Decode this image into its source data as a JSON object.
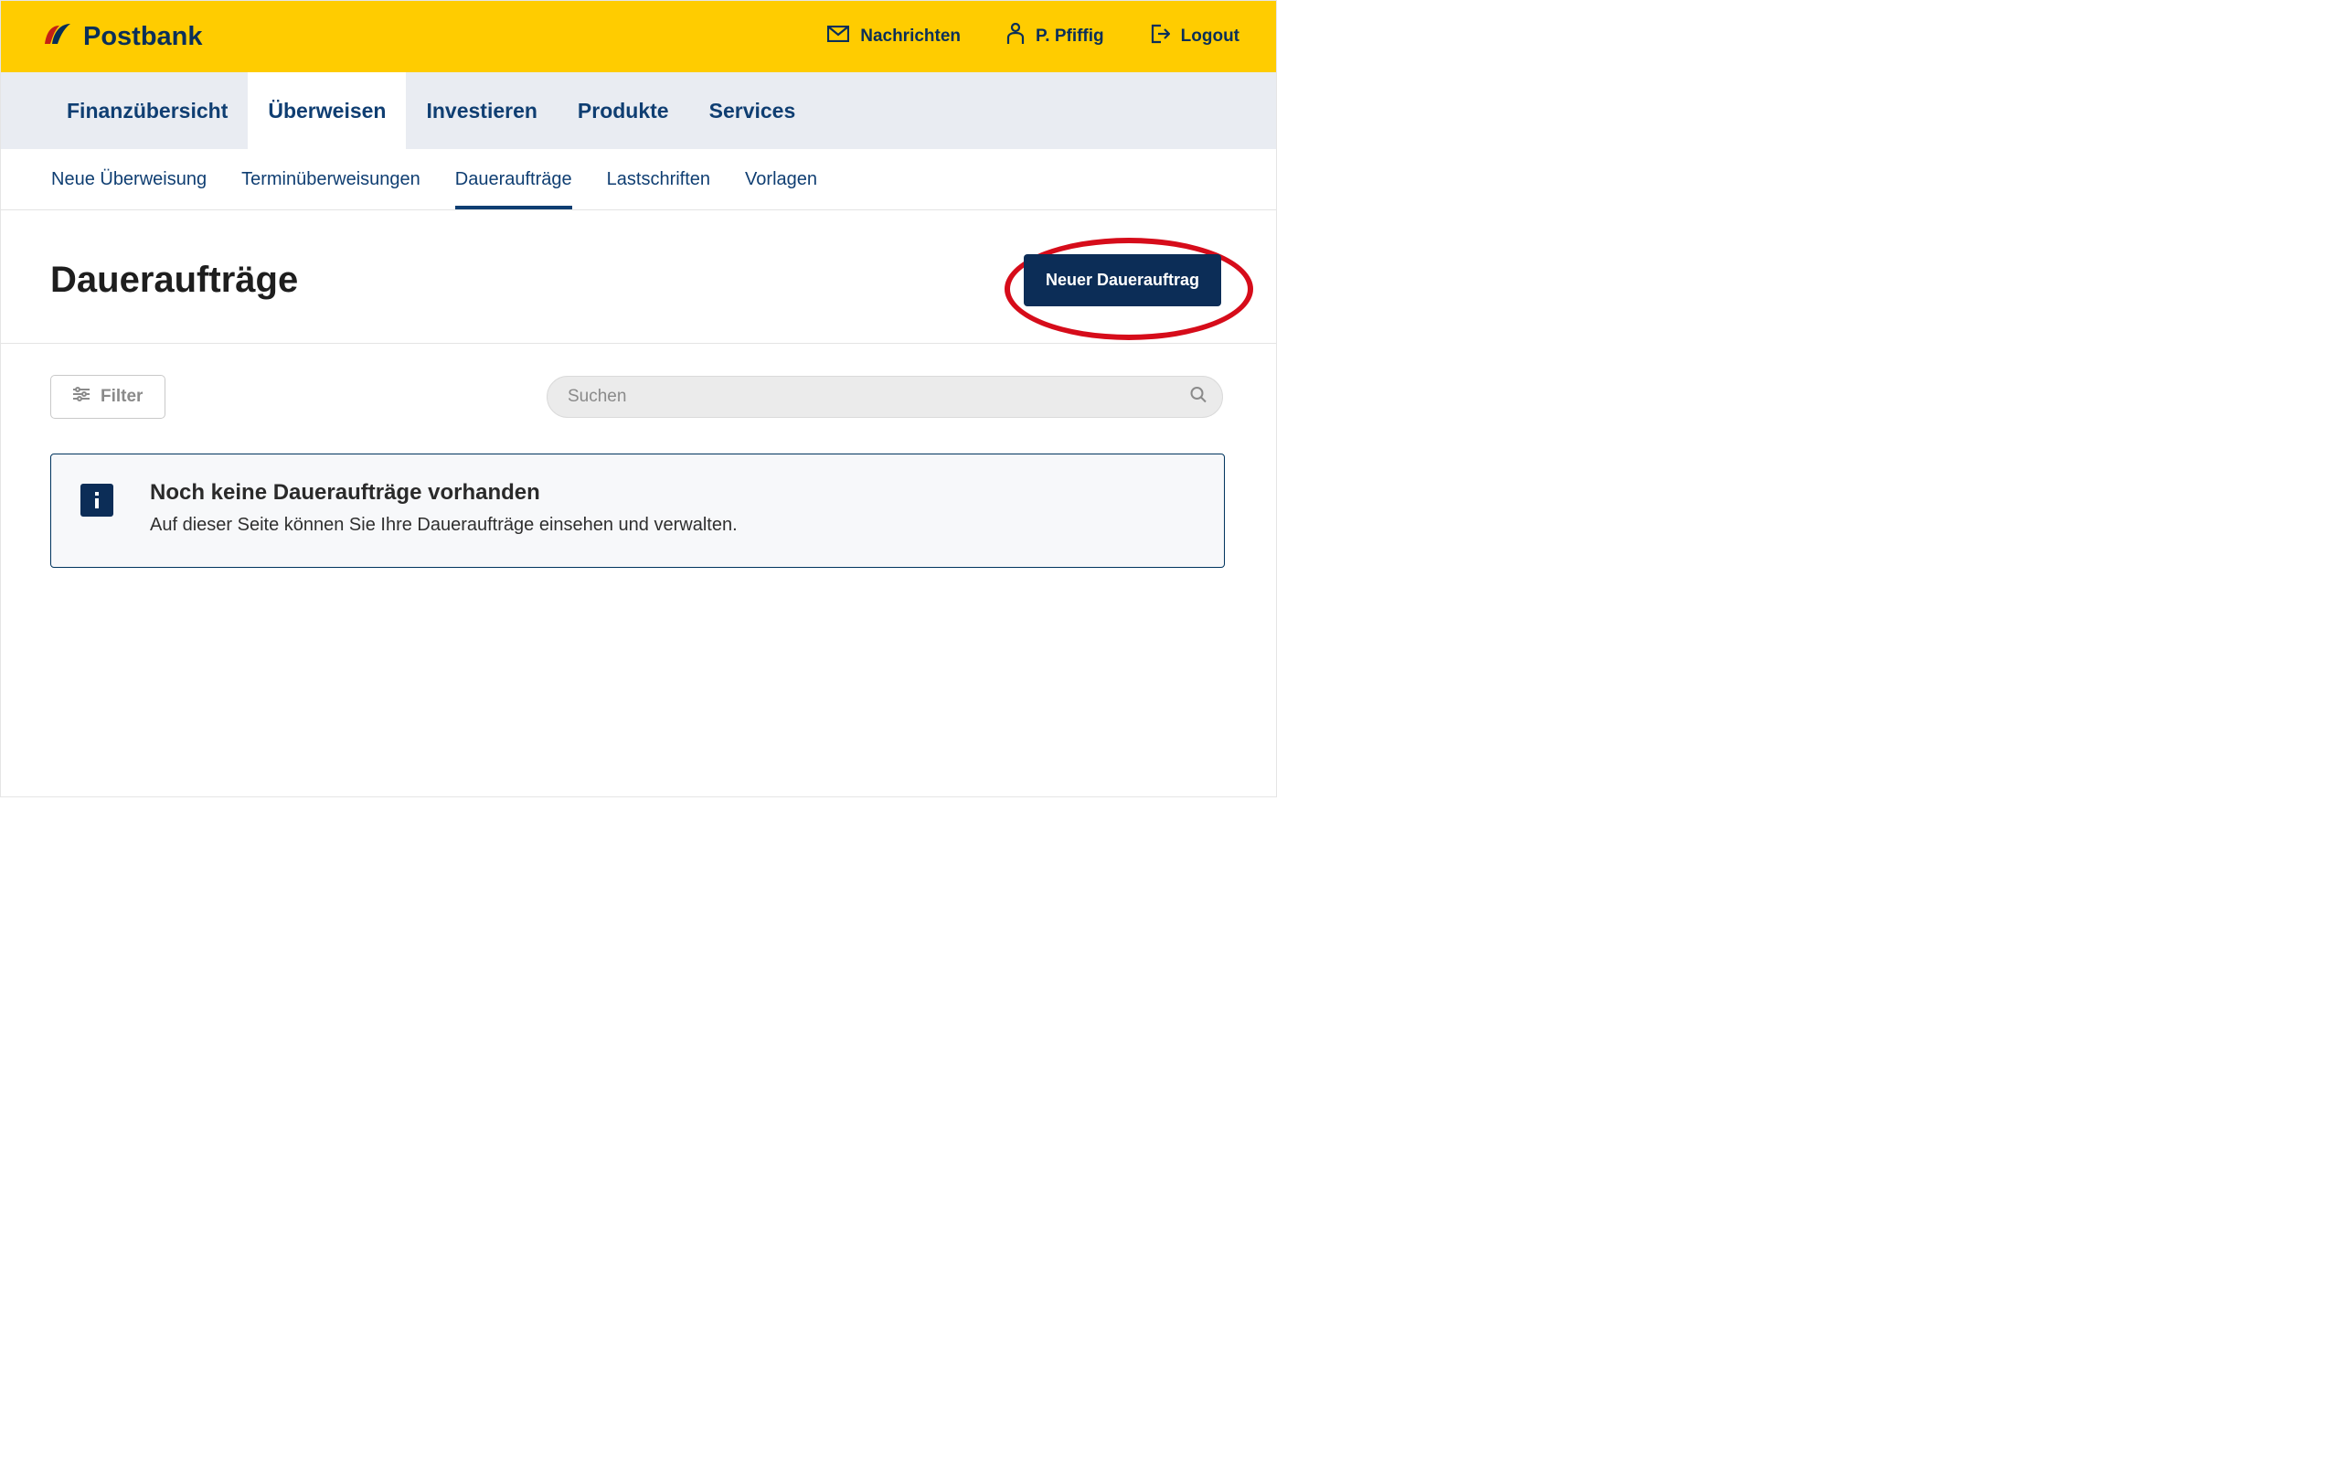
{
  "brand": {
    "name": "Postbank"
  },
  "header_actions": {
    "messages_label": "Nachrichten",
    "user_label": "P. Pfiffig",
    "logout_label": "Logout"
  },
  "primary_nav": [
    {
      "label": "Finanzübersicht",
      "active": false
    },
    {
      "label": "Überweisen",
      "active": true
    },
    {
      "label": "Investieren",
      "active": false
    },
    {
      "label": "Produkte",
      "active": false
    },
    {
      "label": "Services",
      "active": false
    }
  ],
  "sub_nav": [
    {
      "label": "Neue Überweisung",
      "active": false
    },
    {
      "label": "Terminüberweisungen",
      "active": false
    },
    {
      "label": "Daueraufträge",
      "active": true
    },
    {
      "label": "Lastschriften",
      "active": false
    },
    {
      "label": "Vorlagen",
      "active": false
    }
  ],
  "page": {
    "title": "Daueraufträge",
    "new_button": "Neuer Dauerauftrag"
  },
  "controls": {
    "filter_label": "Filter",
    "search_placeholder": "Suchen"
  },
  "info": {
    "title": "Noch keine Daueraufträge vorhanden",
    "description": "Auf dieser Seite können Sie Ihre Daueraufträge einsehen und verwalten."
  }
}
